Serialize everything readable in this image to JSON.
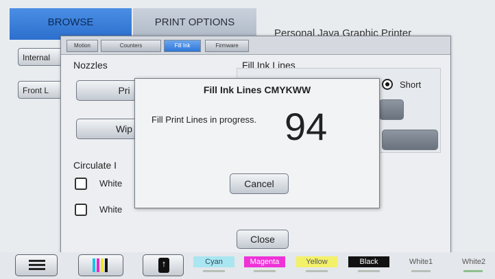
{
  "main_tabs": {
    "browse": "BROWSE",
    "print_options": "PRINT OPTIONS"
  },
  "app_title": "Personal Java Graphic Printer",
  "side_buttons": {
    "internal": "Internal",
    "front": "Front L"
  },
  "dialog": {
    "subtabs": {
      "motion": "Motion",
      "counters": "Counters",
      "fill_ink": "Fill Ink",
      "firmware": "Firmware"
    },
    "nozzles_label": "Nozzles",
    "prime_label": "Pri",
    "wipe_label": "Wip",
    "fill_ink_lines_label": "Fill Ink Lines",
    "short_label": "Short",
    "circulate_label": "Circulate I",
    "white1_label": "White",
    "white2_label": "White",
    "close_label": "Close"
  },
  "popup": {
    "title": "Fill Ink Lines CMYKWW",
    "message": "Fill Print Lines in progress.",
    "count": "94",
    "cancel_label": "Cancel"
  },
  "ink_bar": {
    "cyan": "Cyan",
    "magenta": "Magenta",
    "yellow": "Yellow",
    "black": "Black",
    "white1": "White1",
    "white2": "White2"
  },
  "colors": {
    "accent": "#2f76d8",
    "cyan": "#a9e6f2",
    "magenta": "#ee32d8",
    "yellow": "#f3f16a",
    "black": "#111111"
  },
  "icons": {
    "menu": "hamburger-icon",
    "ink": "ink-cartridges-icon",
    "upload": "upload-icon"
  }
}
